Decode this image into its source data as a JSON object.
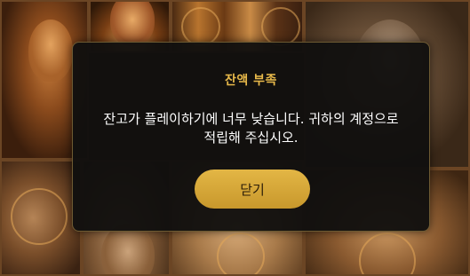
{
  "dialog": {
    "title": "잔액 부족",
    "message": "잔고가 플레이하기에 너무 낮습니다. 귀하의 계정으로 적립해 주십시오.",
    "close_label": "닫기"
  },
  "colors": {
    "title": "#e8b94a",
    "button": "#d9aa3a",
    "modal_bg": "#11100f",
    "text": "#ffffff"
  }
}
